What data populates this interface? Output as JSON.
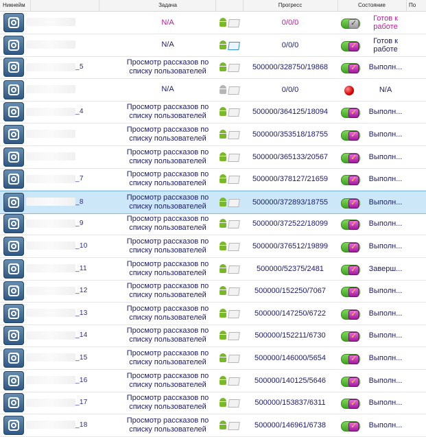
{
  "header": {
    "nickname": "Никнейм",
    "task": "Задача",
    "progress": "Прогресс",
    "state": "Состояние",
    "extra": "По"
  },
  "rows": [
    {
      "user_tail": "",
      "task": "N/A",
      "task_na": true,
      "platform": "android-windows-gray",
      "progress": "0/0/0",
      "zero": true,
      "status": "toggle-gray",
      "state": "Готов к работе",
      "state_pink": true
    },
    {
      "user_tail": "",
      "task": "N/A",
      "task_na": false,
      "platform": "android-windows-blue",
      "progress": "0/0/0",
      "zero": false,
      "status": "toggle-check",
      "state": "Готов к работе",
      "state_pink": false
    },
    {
      "user_tail": "_5",
      "task": "Просмотр рассказов по списку пользователей",
      "task_na": false,
      "platform": "android-windows-gray",
      "progress": "500000/328750/19868",
      "zero": false,
      "status": "toggle-check",
      "state": "Выполн...",
      "state_pink": false
    },
    {
      "user_tail": "",
      "task": "N/A",
      "task_na": false,
      "platform": "android-gray-windows-gray",
      "progress": "0/0/0",
      "zero": false,
      "status": "red-dot",
      "state": "N/A",
      "state_pink": false
    },
    {
      "user_tail": "_4",
      "task": "Просмотр рассказов по списку пользователей",
      "task_na": false,
      "platform": "android-windows-gray",
      "progress": "500000/364125/18094",
      "zero": false,
      "status": "toggle-check",
      "state": "Выполн...",
      "state_pink": false
    },
    {
      "user_tail": "",
      "task": "Просмотр рассказов по списку пользователей",
      "task_na": false,
      "platform": "android-windows-gray",
      "progress": "500000/353518/18755",
      "zero": false,
      "status": "toggle-check",
      "state": "Выполн...",
      "state_pink": false
    },
    {
      "user_tail": "",
      "task": "Просмотр рассказов по списку пользователей",
      "task_na": false,
      "platform": "android-windows-gray",
      "progress": "500000/365133/20567",
      "zero": false,
      "status": "toggle-check",
      "state": "Выполн...",
      "state_pink": false
    },
    {
      "user_tail": "_7",
      "task": "Просмотр рассказов по списку пользователей",
      "task_na": false,
      "platform": "android-windows-gray",
      "progress": "500000/378127/21659",
      "zero": false,
      "status": "toggle-check",
      "state": "Выполн...",
      "state_pink": false
    },
    {
      "user_tail": "_8",
      "task": "Просмотр рассказов по списку пользователей",
      "task_na": false,
      "platform": "android-windows-gray",
      "progress": "500000/372893/18755",
      "zero": false,
      "status": "toggle-check",
      "state": "Выполн...",
      "state_pink": false,
      "selected": true
    },
    {
      "user_tail": "_9",
      "task": "Просмотр рассказов по списку пользователей",
      "task_na": false,
      "platform": "android-windows-gray",
      "progress": "500000/372522/18099",
      "zero": false,
      "status": "toggle-check",
      "state": "Выполн...",
      "state_pink": false
    },
    {
      "user_tail": "_10",
      "task": "Просмотр рассказов по списку пользователей",
      "task_na": false,
      "platform": "android-windows-gray",
      "progress": "500000/376512/19899",
      "zero": false,
      "status": "toggle-check",
      "state": "Выполн...",
      "state_pink": false
    },
    {
      "user_tail": "_11",
      "task": "Просмотр рассказов по списку пользователей",
      "task_na": false,
      "platform": "android-windows-gray",
      "progress": "500000/52375/2481",
      "zero": false,
      "status": "toggle-check",
      "state": "Заверш...",
      "state_pink": false
    },
    {
      "user_tail": "_12",
      "task": "Просмотр рассказов по списку пользователей",
      "task_na": false,
      "platform": "android-windows-gray",
      "progress": "500000/152250/7067",
      "zero": false,
      "status": "toggle-check",
      "state": "Выполн...",
      "state_pink": false
    },
    {
      "user_tail": "_13",
      "task": "Просмотр рассказов по списку пользователей",
      "task_na": false,
      "platform": "android-windows-gray",
      "progress": "500000/147250/6722",
      "zero": false,
      "status": "toggle-check",
      "state": "Выполн...",
      "state_pink": false
    },
    {
      "user_tail": "_14",
      "task": "Просмотр рассказов по списку пользователей",
      "task_na": false,
      "platform": "android-windows-gray",
      "progress": "500000/152211/6730",
      "zero": false,
      "status": "toggle-check",
      "state": "Выполн...",
      "state_pink": false
    },
    {
      "user_tail": "_15",
      "task": "Просмотр рассказов по списку пользователей",
      "task_na": false,
      "platform": "android-windows-gray",
      "progress": "500000/146000/5654",
      "zero": false,
      "status": "toggle-check",
      "state": "Выполн...",
      "state_pink": false
    },
    {
      "user_tail": "_16",
      "task": "Просмотр рассказов по списку пользователей",
      "task_na": false,
      "platform": "android-windows-gray",
      "progress": "500000/140125/5646",
      "zero": false,
      "status": "toggle-check",
      "state": "Выполн...",
      "state_pink": false
    },
    {
      "user_tail": "_17",
      "task": "Просмотр рассказов по списку пользователей",
      "task_na": false,
      "platform": "android-windows-gray",
      "progress": "500000/153837/6311",
      "zero": false,
      "status": "toggle-check",
      "state": "Выполн...",
      "state_pink": false
    },
    {
      "user_tail": "_18",
      "task": "Просмотр рассказов по списку пользователей",
      "task_na": false,
      "platform": "android-windows-gray",
      "progress": "500000/146961/6738",
      "zero": false,
      "status": "toggle-check",
      "state": "Выполн...",
      "state_pink": false
    }
  ]
}
